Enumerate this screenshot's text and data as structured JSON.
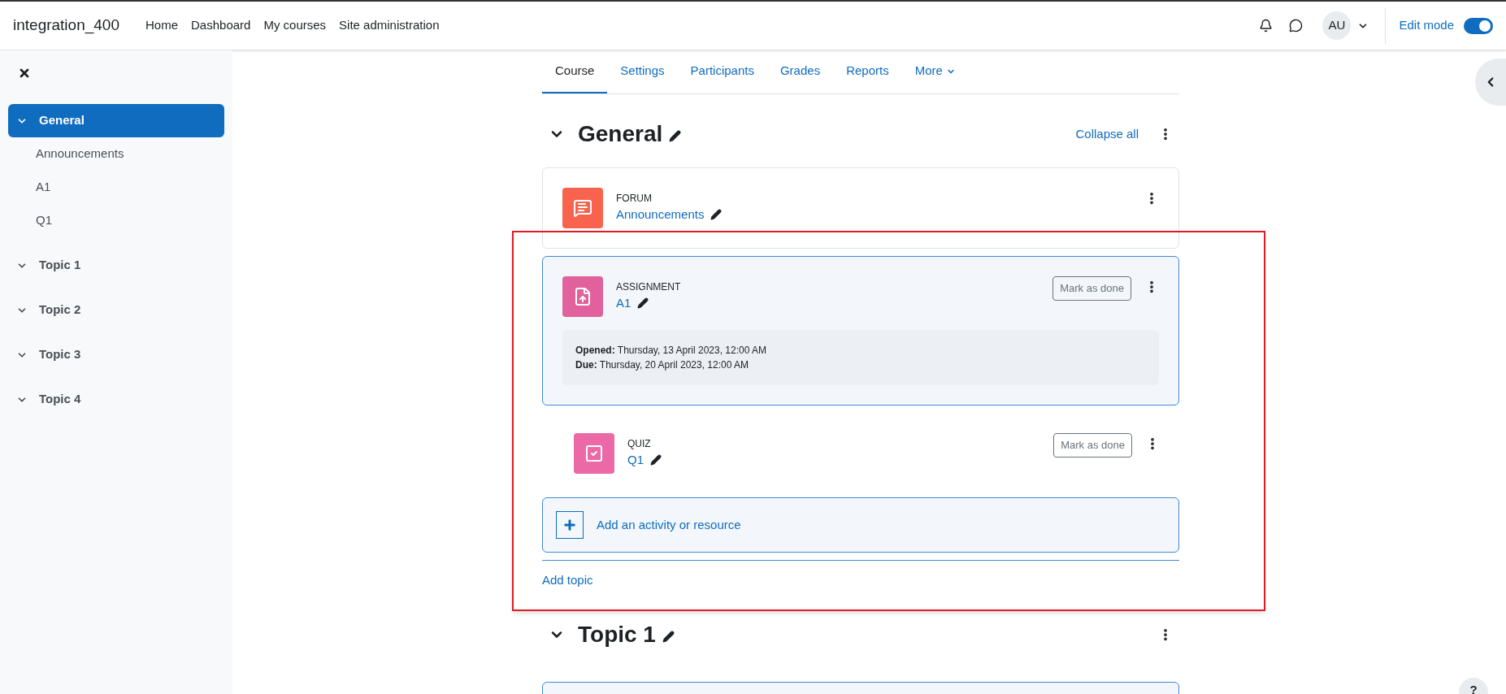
{
  "site_name": "integration_400",
  "nav": [
    {
      "label": "Home"
    },
    {
      "label": "Dashboard"
    },
    {
      "label": "My courses"
    },
    {
      "label": "Site administration"
    }
  ],
  "user": {
    "initials": "AU"
  },
  "edit_mode": {
    "label": "Edit mode",
    "on": true
  },
  "sidebar": {
    "items": [
      {
        "label": "General",
        "selected": true,
        "expanded": true,
        "children": [
          {
            "label": "Announcements"
          },
          {
            "label": "A1"
          },
          {
            "label": "Q1"
          }
        ]
      },
      {
        "label": "Topic 1",
        "selected": false,
        "expanded": true
      },
      {
        "label": "Topic 2",
        "selected": false,
        "expanded": true
      },
      {
        "label": "Topic 3",
        "selected": false,
        "expanded": true
      },
      {
        "label": "Topic 4",
        "selected": false,
        "expanded": true
      }
    ]
  },
  "tabs": [
    {
      "label": "Course",
      "selected": true,
      "menu": false
    },
    {
      "label": "Settings",
      "selected": false,
      "menu": false
    },
    {
      "label": "Participants",
      "selected": false,
      "menu": false
    },
    {
      "label": "Grades",
      "selected": false,
      "menu": false
    },
    {
      "label": "Reports",
      "selected": false,
      "menu": false
    },
    {
      "label": "More",
      "selected": false,
      "menu": true
    }
  ],
  "sections": [
    {
      "title": "General",
      "expanded": true,
      "collapse_all": "Collapse all",
      "activities": [
        {
          "kind": "forum",
          "bordered": true,
          "highlighted": false,
          "type_label": "FORUM",
          "name": "Announcements"
        },
        {
          "kind": "assignment",
          "bordered": true,
          "highlighted": true,
          "type_label": "ASSIGNMENT",
          "name": "A1",
          "mark_done": "Mark as done",
          "dates": [
            {
              "label": "Opened:",
              "value": "Thursday, 13 April 2023, 12:00 AM"
            },
            {
              "label": "Due:",
              "value": "Thursday, 20 April 2023, 12:00 AM"
            }
          ]
        },
        {
          "kind": "quiz",
          "bordered": false,
          "highlighted": false,
          "type_label": "QUIZ",
          "name": "Q1",
          "mark_done": "Mark as done"
        }
      ],
      "add_activity": "Add an activity or resource",
      "add_topic": "Add topic"
    },
    {
      "title": "Topic 1",
      "expanded": true
    }
  ],
  "help_button": "?"
}
